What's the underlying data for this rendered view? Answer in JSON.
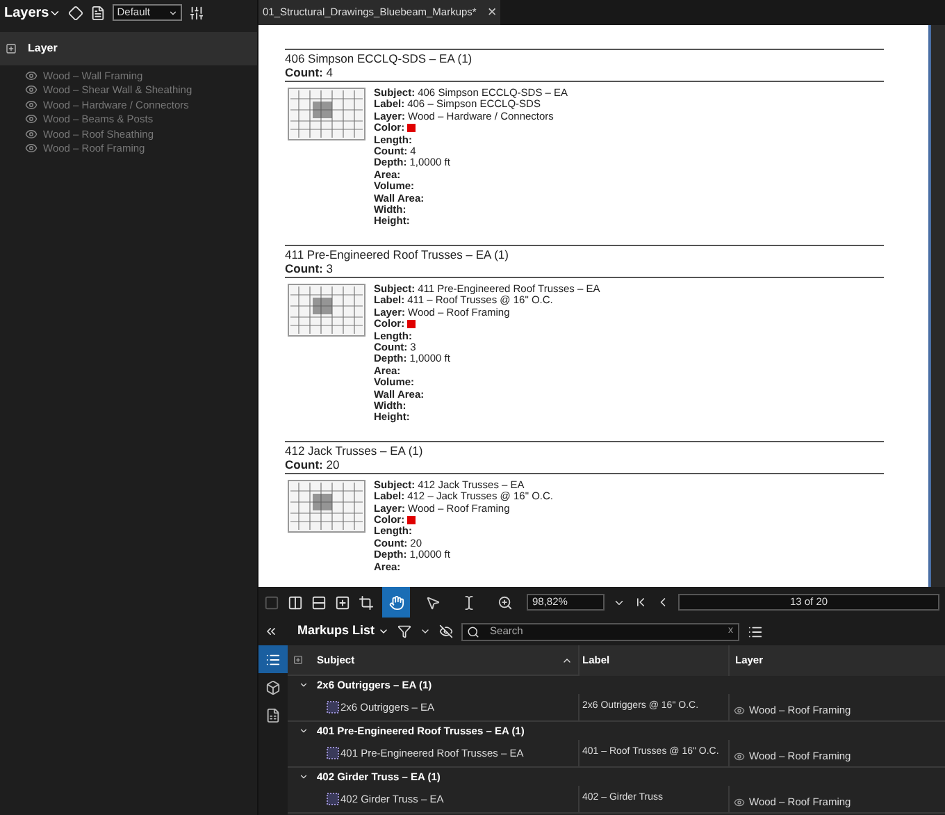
{
  "layers_panel": {
    "title": "Layers",
    "view": "Default",
    "header": "Layer",
    "items": [
      {
        "name": "Wood – Wall Framing"
      },
      {
        "name": "Wood – Shear Wall & Sheathing"
      },
      {
        "name": "Wood – Hardware / Connectors"
      },
      {
        "name": "Wood – Beams & Posts"
      },
      {
        "name": "Wood – Roof Sheathing"
      },
      {
        "name": "Wood – Roof Framing"
      }
    ]
  },
  "document_tab": {
    "title": "01_Structural_Drawings_Bluebeam_Markups*",
    "close": "×"
  },
  "page": {
    "sections": [
      {
        "heading": "406 Simpson ECCLQ-SDS – EA (1)",
        "count_label": "Count:",
        "count": "4",
        "fields": [
          {
            "label": "Subject:",
            "value": "406 Simpson ECCLQ-SDS – EA"
          },
          {
            "label": "Label:",
            "value": "406 – Simpson ECCLQ-SDS"
          },
          {
            "label": "Layer:",
            "value": "Wood – Hardware / Connectors"
          },
          {
            "label": "Color:",
            "color": "#e00000"
          },
          {
            "label": "Length:"
          },
          {
            "label": "Count:",
            "value": "4"
          },
          {
            "label": "Depth:",
            "value": "1,0000 ft"
          },
          {
            "label": "Area:"
          },
          {
            "label": "Volume:"
          },
          {
            "label": "Wall Area:"
          },
          {
            "label": "Width:"
          },
          {
            "label": "Height:"
          }
        ]
      },
      {
        "heading": "411 Pre-Engineered Roof Trusses – EA (1)",
        "count_label": "Count:",
        "count": "3",
        "fields": [
          {
            "label": "Subject:",
            "value": "411 Pre-Engineered Roof Trusses – EA"
          },
          {
            "label": "Label:",
            "value": "411 – Roof Trusses @ 16\" O.C."
          },
          {
            "label": "Layer:",
            "value": "Wood – Roof Framing"
          },
          {
            "label": "Color:",
            "color": "#e00000"
          },
          {
            "label": "Length:"
          },
          {
            "label": "Count:",
            "value": "3"
          },
          {
            "label": "Depth:",
            "value": "1,0000 ft"
          },
          {
            "label": "Area:"
          },
          {
            "label": "Volume:"
          },
          {
            "label": "Wall Area:"
          },
          {
            "label": "Width:"
          },
          {
            "label": "Height:"
          }
        ]
      },
      {
        "heading": "412 Jack Trusses – EA (1)",
        "count_label": "Count:",
        "count": "20",
        "fields": [
          {
            "label": "Subject:",
            "value": "412 Jack Trusses – EA"
          },
          {
            "label": "Label:",
            "value": "412 – Jack Trusses @ 16\" O.C."
          },
          {
            "label": "Layer:",
            "value": "Wood – Roof Framing"
          },
          {
            "label": "Color:",
            "color": "#e00000"
          },
          {
            "label": "Length:"
          },
          {
            "label": "Count:",
            "value": "20"
          },
          {
            "label": "Depth:",
            "value": "1,0000 ft"
          },
          {
            "label": "Area:"
          }
        ]
      }
    ]
  },
  "toolbar": {
    "tools": [
      {
        "kind": "hand",
        "selected": true
      },
      {
        "kind": "select",
        "selected": false
      },
      {
        "kind": "text-select",
        "selected": false
      },
      {
        "kind": "zoom",
        "selected": false
      }
    ],
    "zoom": "98,82%",
    "page_indicator": "13 of 20"
  },
  "markups_list": {
    "title": "Markups List",
    "search": {
      "placeholder": "Search",
      "clear": "x"
    },
    "side_tabs": [
      {
        "kind": "list",
        "selected": true
      },
      {
        "kind": "cube",
        "selected": false
      },
      {
        "kind": "document",
        "selected": false
      }
    ],
    "columns": [
      "Subject",
      "Label",
      "Layer"
    ],
    "groups": [
      {
        "title": "2x6 Outriggers – EA (1)",
        "expanded": true,
        "rows": [
          {
            "subject": "2x6 Outriggers – EA",
            "label": "2x6 Outriggers @ 16\" O.C.",
            "layer": "Wood – Roof Framing"
          }
        ]
      },
      {
        "title": "401 Pre-Engineered Roof Trusses – EA (1)",
        "expanded": true,
        "rows": [
          {
            "subject": "401 Pre-Engineered Roof Trusses – EA",
            "label": "401 – Roof Trusses @ 16\" O.C.",
            "layer": "Wood – Roof Framing"
          }
        ]
      },
      {
        "title": "402 Girder Truss – EA (1)",
        "expanded": true,
        "rows": [
          {
            "subject": "402 Girder Truss – EA",
            "label": "402 – Girder Truss",
            "layer": "Wood – Roof Framing"
          }
        ]
      }
    ]
  }
}
